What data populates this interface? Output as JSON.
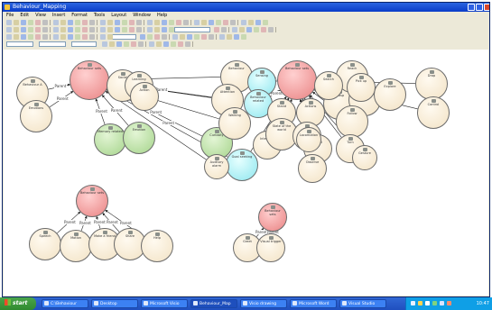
{
  "window": {
    "title": "Behaviour_Mapping"
  },
  "menu": [
    "File",
    "Edit",
    "View",
    "Insert",
    "Format",
    "Tools",
    "Layout",
    "Window",
    "Help"
  ],
  "colors": {
    "red": "#e98282",
    "beige": "#f2e2c4",
    "green": "#a5d48b",
    "cyan": "#8ee6ee",
    "edge": "#222222",
    "titlebar": "#0a3cc8",
    "taskbar": "#1f4fbf"
  },
  "edge_label": "Parent",
  "nodes": [
    {
      "id": "hub1",
      "color": "red",
      "label": "Behaviour sets"
    },
    {
      "id": "hub2",
      "color": "red",
      "label": "Behaviour sets"
    },
    {
      "id": "hub3",
      "color": "red",
      "label": "Behaviour sets"
    },
    {
      "id": "hub4",
      "color": "red",
      "label": "Behaviour sets"
    },
    {
      "id": "n1",
      "color": "beige",
      "label": "Behaviour A"
    },
    {
      "id": "n2",
      "color": "beige",
      "label": "Emotions"
    },
    {
      "id": "n3",
      "color": "beige",
      "label": "Social"
    },
    {
      "id": "n4",
      "color": "beige",
      "label": "Learning"
    },
    {
      "id": "n5",
      "color": "beige",
      "label": "Action"
    },
    {
      "id": "n6",
      "color": "green",
      "label": "Memory related"
    },
    {
      "id": "n7",
      "color": "green",
      "label": "Emotion"
    },
    {
      "id": "n8",
      "color": "green",
      "label": "Curiosity"
    },
    {
      "id": "n9",
      "color": "beige",
      "label": "Behaviour"
    },
    {
      "id": "n10",
      "color": "beige",
      "label": "Attention"
    },
    {
      "id": "n11",
      "color": "beige",
      "label": "Walking"
    },
    {
      "id": "n12",
      "color": "cyan",
      "label": "Sensing"
    },
    {
      "id": "n13",
      "color": "cyan",
      "label": "Behaviour related"
    },
    {
      "id": "n14",
      "color": "cyan",
      "label": "Goal seeking"
    },
    {
      "id": "n15",
      "color": "beige",
      "label": "Stand"
    },
    {
      "id": "n16",
      "color": "beige",
      "label": "Intention"
    },
    {
      "id": "n17",
      "color": "beige",
      "label": "State of the world"
    },
    {
      "id": "n18",
      "color": "beige",
      "label": "Actions"
    },
    {
      "id": "n19",
      "color": "beige",
      "label": "Move"
    },
    {
      "id": "n20",
      "color": "beige",
      "label": "Avoid"
    },
    {
      "id": "n21",
      "color": "beige",
      "label": "Grasp"
    },
    {
      "id": "n22",
      "color": "beige",
      "label": "Reach"
    },
    {
      "id": "n23",
      "color": "beige",
      "label": "Look at"
    },
    {
      "id": "n24",
      "color": "beige",
      "label": "Explore"
    },
    {
      "id": "n25",
      "color": "beige",
      "label": "Follow"
    },
    {
      "id": "n26",
      "color": "beige",
      "label": "Turn"
    },
    {
      "id": "n27",
      "color": "beige",
      "label": "Search"
    },
    {
      "id": "n28",
      "color": "beige",
      "label": "Pick up"
    },
    {
      "id": "n29",
      "color": "beige",
      "label": "Drop"
    },
    {
      "id": "n30",
      "color": "beige",
      "label": "Control"
    },
    {
      "id": "n31",
      "color": "beige",
      "label": "Observe"
    },
    {
      "id": "n32",
      "color": "beige",
      "label": "Locomotion"
    },
    {
      "id": "n33",
      "color": "beige",
      "label": "Gesture"
    },
    {
      "id": "n34",
      "color": "beige",
      "label": "Speech"
    },
    {
      "id": "n35",
      "color": "beige",
      "label": "Motion"
    },
    {
      "id": "n36",
      "color": "beige",
      "label": "Make a friend"
    },
    {
      "id": "n37",
      "color": "beige",
      "label": "Share"
    },
    {
      "id": "n38",
      "color": "beige",
      "label": "Help"
    },
    {
      "id": "n39",
      "color": "beige",
      "label": "Greet"
    },
    {
      "id": "n40",
      "color": "beige",
      "label": "Visual trigger"
    },
    {
      "id": "n41",
      "color": "beige",
      "label": "Auditory alarm"
    }
  ],
  "taskbar": {
    "start": "start",
    "tasks": [
      "C:\\Behaviour",
      "Desktop",
      "Microsoft Visio",
      "Behaviour_Map",
      "Visio drawing",
      "Microsoft Word",
      "Visual Studio"
    ],
    "clock": "10:47"
  }
}
